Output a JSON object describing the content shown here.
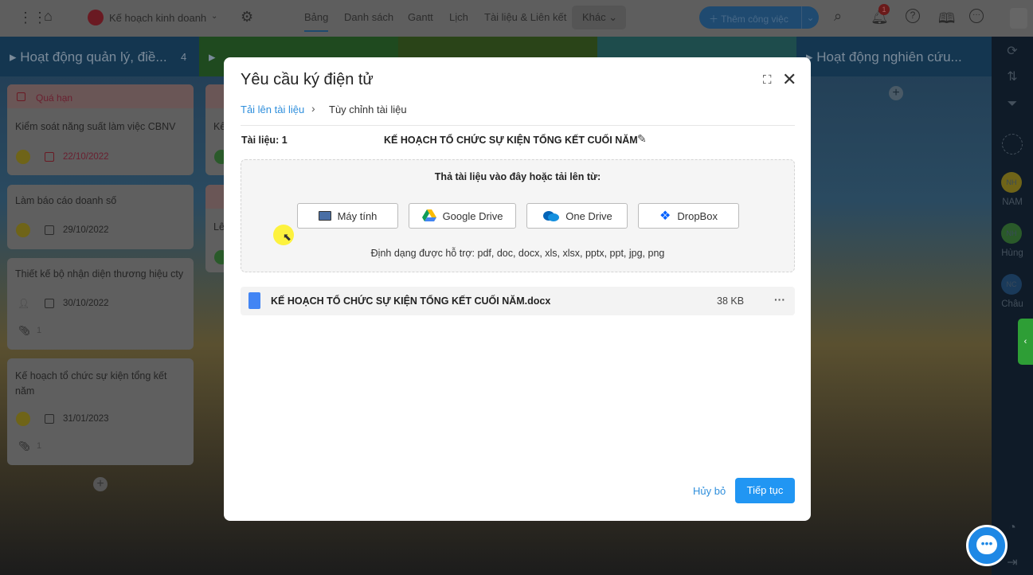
{
  "topbar": {
    "project": "Kế hoạch kinh doanh",
    "tabs": [
      "Bảng",
      "Danh sách",
      "Gantt",
      "Lịch",
      "Tài liệu & Liên kết"
    ],
    "more": "Khác",
    "add_task": "Thêm công việc",
    "notif_count": "1",
    "accent": "#1f5a8a"
  },
  "columns": [
    {
      "title": "Hoạt động quản lý, điề...",
      "count": "4",
      "color": "#143650"
    },
    {
      "title": "",
      "color": "#1f4a1f"
    },
    {
      "title": "",
      "color": "#2a4418"
    },
    {
      "title": "",
      "color": "#1e4c4c"
    },
    {
      "title": "Hoạt động nghiên cứu...",
      "color": "#143650"
    }
  ],
  "cards": [
    {
      "badge": "Quá hạn",
      "title": "Kiểm soát năng suất làm việc CBNV",
      "avatar": "MH",
      "date": "22/10/2022"
    },
    {
      "title": "Làm báo cáo doanh số",
      "avatar": "MH",
      "date": "29/10/2022"
    },
    {
      "title": "Thiết kế bộ nhận diện thương hiệu cty",
      "date": "30/10/2022",
      "attachments": "1"
    },
    {
      "title": "Kế hoạch tổ chức sự kiện tổng kết năm",
      "avatar": "MH",
      "date": "31/01/2023",
      "attachments": "1"
    }
  ],
  "col2_cards": [
    "Kế",
    "Lê"
  ],
  "rail": {
    "members": [
      {
        "initials": "NH",
        "name": "NAM"
      },
      {
        "initials": "NH",
        "name": "Hùng"
      },
      {
        "initials": "NC",
        "name": "Châu"
      }
    ]
  },
  "modal": {
    "title": "Yêu cầu ký điện tử",
    "steps": [
      "Tải lên tài liệu",
      "Tùy chỉnh tài liệu"
    ],
    "doc_count_label": "Tài liệu: 1",
    "doc_name": "KẾ HOẠCH TỔ CHỨC SỰ KIỆN TỔNG KẾT CUỐI NĂM",
    "drop_text": "Thả tài liệu vào đây hoặc tải lên từ:",
    "sources": [
      "Máy tính",
      "Google Drive",
      "One Drive",
      "DropBox"
    ],
    "formats": "Định dạng được hỗ trợ: pdf, doc, docx, xls, xlsx, pptx, ppt, jpg, png",
    "file": {
      "name": "KẾ HOẠCH TỔ CHỨC SỰ KIỆN TỔNG KẾT CUỐI NĂM.docx",
      "size": "38 KB"
    },
    "cancel": "Hủy bỏ",
    "continue": "Tiếp tục",
    "primary": "#2196f3"
  }
}
